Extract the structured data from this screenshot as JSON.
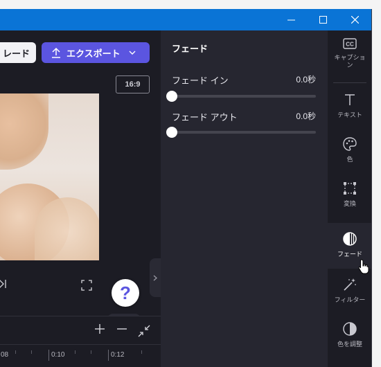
{
  "window": {
    "controls": {
      "minimize_icon": "minimize-icon",
      "maximize_icon": "maximize-icon",
      "close_icon": "close-icon"
    }
  },
  "header": {
    "upgrade_label": "レード",
    "export_label": "エクスポート",
    "export_color": "#5b55e0"
  },
  "preview": {
    "aspect_ratio": "16:9",
    "help_label": "?"
  },
  "timeline": {
    "ticks": [
      "08",
      "0:10",
      "0:12"
    ]
  },
  "fade_panel": {
    "title": "フェード",
    "fade_in": {
      "label": "フェード イン",
      "value": "0.0秒",
      "position": 0
    },
    "fade_out": {
      "label": "フェード アウト",
      "value": "0.0秒",
      "position": 0
    }
  },
  "rail": {
    "items": [
      {
        "label": "キャプション",
        "icon": "cc-icon"
      },
      {
        "label": "テキスト",
        "icon": "text-icon"
      },
      {
        "label": "色",
        "icon": "palette-icon"
      },
      {
        "label": "変換",
        "icon": "transform-icon"
      },
      {
        "label": "フェード",
        "icon": "fade-icon",
        "active": true
      },
      {
        "label": "フィルター",
        "icon": "magic-wand-icon"
      },
      {
        "label": "色を調整",
        "icon": "adjust-color-icon"
      }
    ]
  }
}
